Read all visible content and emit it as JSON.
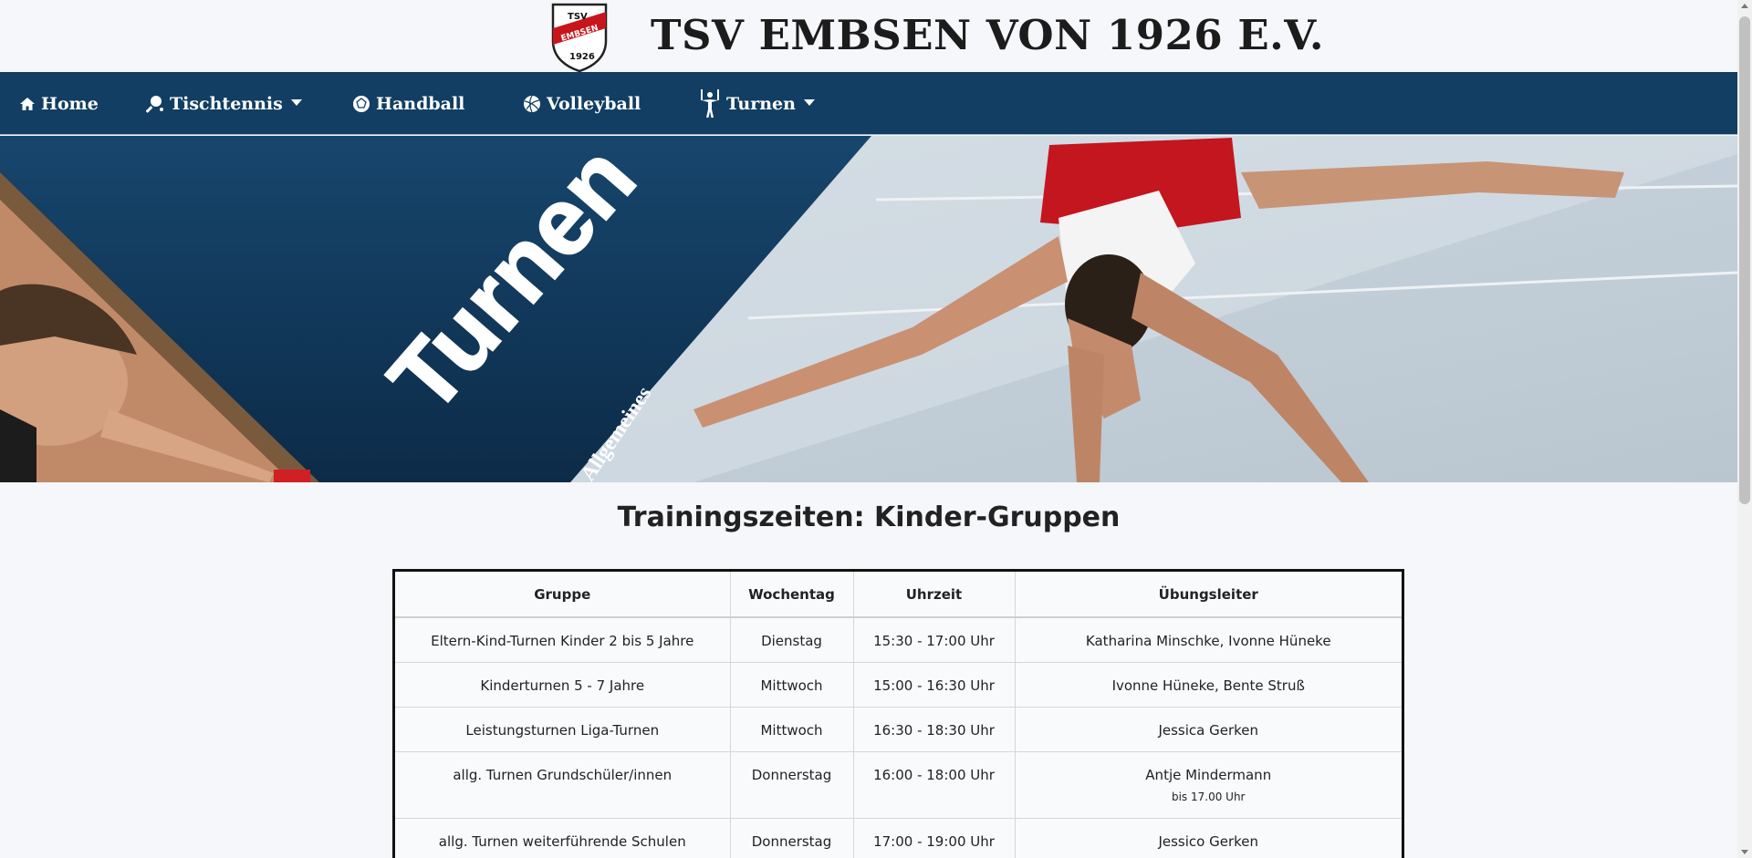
{
  "header": {
    "title": "TSV EMBSEN VON 1926 E.V.",
    "logo": {
      "top_text": "TSV",
      "band_text": "EMBSEN",
      "year": "1926",
      "band_color": "#c8151c"
    }
  },
  "nav": {
    "background": "#113e62",
    "items": [
      {
        "label": "Home",
        "icon": "home-icon",
        "dropdown": false
      },
      {
        "label": "Tischtennis",
        "icon": "table-tennis-icon",
        "dropdown": true
      },
      {
        "label": "Handball",
        "icon": "handball-icon",
        "dropdown": false
      },
      {
        "label": "Volleyball",
        "icon": "volleyball-icon",
        "dropdown": false
      },
      {
        "label": "Turnen",
        "icon": "gymnast-icon",
        "dropdown": true
      }
    ]
  },
  "hero": {
    "title": "Turnen",
    "subtitle": "Allgemeines",
    "panel_color": "#123a5c"
  },
  "section": {
    "title": "Trainingszeiten: Kinder-Gruppen"
  },
  "table": {
    "headers": [
      "Gruppe",
      "Wochentag",
      "Uhrzeit",
      "Übungsleiter"
    ],
    "rows": [
      {
        "gruppe": "Eltern-Kind-Turnen Kinder 2 bis 5 Jahre",
        "tag": "Dienstag",
        "zeit": "15:30 - 17:00 Uhr",
        "leiter": "Katharina Minschke, Ivonne Hüneke",
        "note": ""
      },
      {
        "gruppe": "Kinderturnen 5 - 7 Jahre",
        "tag": "Mittwoch",
        "zeit": "15:00 - 16:30 Uhr",
        "leiter": "Ivonne Hüneke, Bente Struß",
        "note": ""
      },
      {
        "gruppe": "Leistungsturnen Liga-Turnen",
        "tag": "Mittwoch",
        "zeit": "16:30 - 18:30 Uhr",
        "leiter": "Jessica Gerken",
        "note": ""
      },
      {
        "gruppe": "allg. Turnen Grundschüler/innen",
        "tag": "Donnerstag",
        "zeit": "16:00 - 18:00 Uhr",
        "leiter": "Antje Mindermann",
        "note": "bis 17.00 Uhr"
      },
      {
        "gruppe": "allg. Turnen weiterführende Schulen",
        "tag": "Donnerstag",
        "zeit": "17:00 - 19:00 Uhr",
        "leiter": "Jessico Gerken",
        "note": ""
      }
    ]
  }
}
